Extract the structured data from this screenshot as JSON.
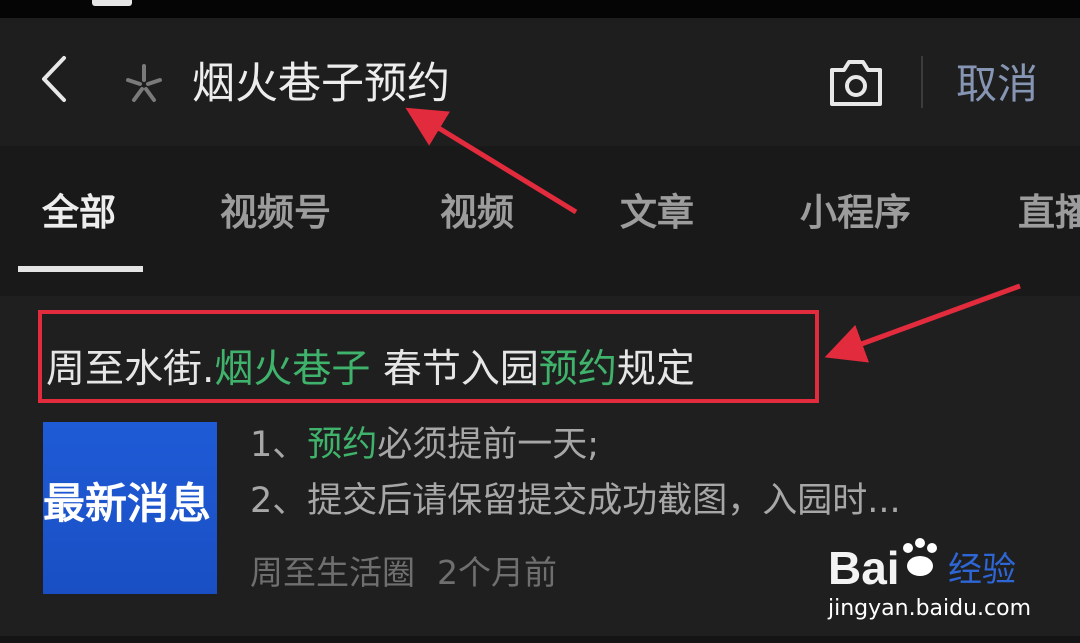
{
  "search": {
    "query": "烟火巷子预约",
    "cancel_label": "取消"
  },
  "icons": {
    "back": "chevron-left-icon",
    "spark": "spark-icon",
    "camera": "camera-icon"
  },
  "tabs": [
    {
      "label": "全部",
      "active": true
    },
    {
      "label": "视频号",
      "active": false
    },
    {
      "label": "视频",
      "active": false
    },
    {
      "label": "文章",
      "active": false
    },
    {
      "label": "小程序",
      "active": false
    },
    {
      "label": "直播",
      "active": false
    }
  ],
  "result": {
    "title_parts": [
      "周至水街.",
      "烟火巷子",
      " 春节入园",
      "预约",
      "规定"
    ],
    "thumbnail_text": "最新消息",
    "snippet_line1_parts": [
      "1、",
      "预约",
      "必须提前一天;"
    ],
    "snippet_line2": "2、提交后请保留提交成功截图，入园时...",
    "source": "周至生活圈",
    "time": "2个月前"
  },
  "watermark": {
    "logo": "Bai",
    "label": "经验",
    "url": "jingyan.baidu.com"
  },
  "colors": {
    "background": "#111111",
    "highlight_green": "#3fb36b",
    "annotation_red": "#e22b3c",
    "link_blue": "#8795b4",
    "thumbnail_blue": "#1f5bd6"
  }
}
